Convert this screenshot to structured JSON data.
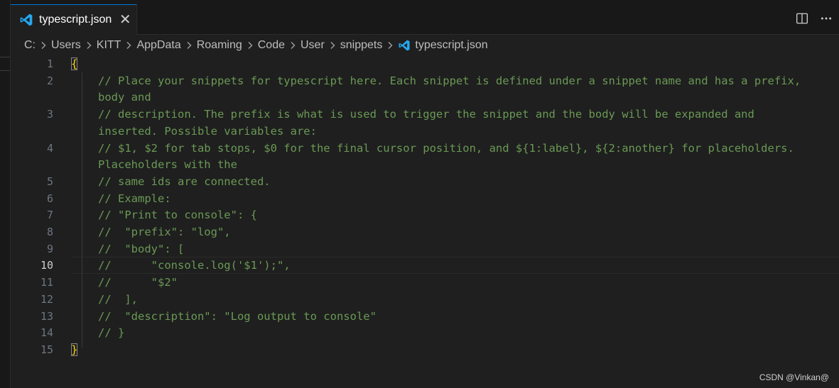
{
  "tab": {
    "filename": "typescript.json",
    "close_glyph": "✕"
  },
  "breadcrumb": {
    "parts": [
      "C:",
      "Users",
      "KITT",
      "AppData",
      "Roaming",
      "Code",
      "User",
      "snippets"
    ],
    "file": "typescript.json"
  },
  "editor": {
    "active_line": 10,
    "lines": [
      {
        "n": "1",
        "text": "{"
      },
      {
        "n": "2",
        "text": "// Place your snippets for typescript here. Each snippet is defined under a snippet name and has a prefix,",
        "wrap": "body and"
      },
      {
        "n": "3",
        "text": "// description. The prefix is what is used to trigger the snippet and the body will be expanded and",
        "wrap": "inserted. Possible variables are:"
      },
      {
        "n": "4",
        "text": "// $1, $2 for tab stops, $0 for the final cursor position, and ${1:label}, ${2:another} for placeholders.",
        "wrap": "Placeholders with the"
      },
      {
        "n": "5",
        "text": "// same ids are connected."
      },
      {
        "n": "6",
        "text": "// Example:"
      },
      {
        "n": "7",
        "text": "// \"Print to console\": {"
      },
      {
        "n": "8",
        "text": "//  \"prefix\": \"log\","
      },
      {
        "n": "9",
        "text": "//  \"body\": ["
      },
      {
        "n": "10",
        "text": "//      \"console.log('$1');\","
      },
      {
        "n": "11",
        "text": "//      \"$2\""
      },
      {
        "n": "12",
        "text": "//  ],"
      },
      {
        "n": "13",
        "text": "//  \"description\": \"Log output to console\""
      },
      {
        "n": "14",
        "text": "// }"
      },
      {
        "n": "15",
        "text": "}"
      }
    ]
  },
  "watermark": "CSDN @Vinkan@",
  "colors": {
    "comment": "#6a9955",
    "brace": "#ffd700",
    "accent": "#0078d4",
    "vscode_blue": "#23a9f2"
  }
}
